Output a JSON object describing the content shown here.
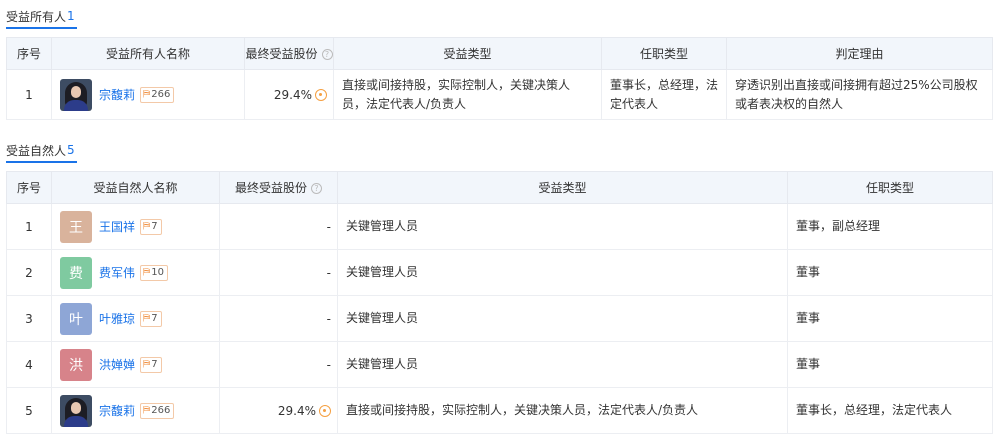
{
  "owners_section": {
    "title": "受益所有人",
    "count": "1",
    "columns": [
      "序号",
      "受益所有人名称",
      "最终受益股份",
      "受益类型",
      "任职类型",
      "判定理由"
    ],
    "rows": [
      {
        "index": "1",
        "name": "宗馥莉",
        "avatar": "photo",
        "tag_count": "266",
        "share": "29.4%",
        "benefit_type": "直接或间接持股，实际控制人，关键决策人员，法定代表人/负责人",
        "position": "董事长，总经理，法定代表人",
        "reason": "穿透识别出直接或间接拥有超过25%公司股权或者表决权的自然人"
      }
    ]
  },
  "persons_section": {
    "title": "受益自然人",
    "count": "5",
    "columns": [
      "序号",
      "受益自然人名称",
      "最终受益股份",
      "受益类型",
      "任职类型"
    ],
    "rows": [
      {
        "index": "1",
        "name": "王国祥",
        "avatar_char": "王",
        "avatar_color": "#d9b39c",
        "tag_count": "7",
        "share": "-",
        "benefit_type": "关键管理人员",
        "position": "董事，副总经理"
      },
      {
        "index": "2",
        "name": "费军伟",
        "avatar_char": "费",
        "avatar_color": "#7fcaa0",
        "tag_count": "10",
        "share": "-",
        "benefit_type": "关键管理人员",
        "position": "董事"
      },
      {
        "index": "3",
        "name": "叶雅琼",
        "avatar_char": "叶",
        "avatar_color": "#8ea6d6",
        "tag_count": "7",
        "share": "-",
        "benefit_type": "关键管理人员",
        "position": "董事"
      },
      {
        "index": "4",
        "name": "洪婵婵",
        "avatar_char": "洪",
        "avatar_color": "#d7838a",
        "tag_count": "7",
        "share": "-",
        "benefit_type": "关键管理人员",
        "position": "董事"
      },
      {
        "index": "5",
        "name": "宗馥莉",
        "avatar": "photo",
        "tag_count": "266",
        "share": "29.4%",
        "benefit_type": "直接或间接持股，实际控制人，关键决策人员，法定代表人/负责人",
        "position": "董事长，总经理，法定代表人"
      }
    ]
  },
  "icons": {
    "help": "question-circle-icon",
    "tag": "company-tag-icon",
    "share_target": "target-icon"
  },
  "colors": {
    "accent": "#1a73e8",
    "header_bg": "#f2f6fb",
    "target": "#f5a042"
  }
}
